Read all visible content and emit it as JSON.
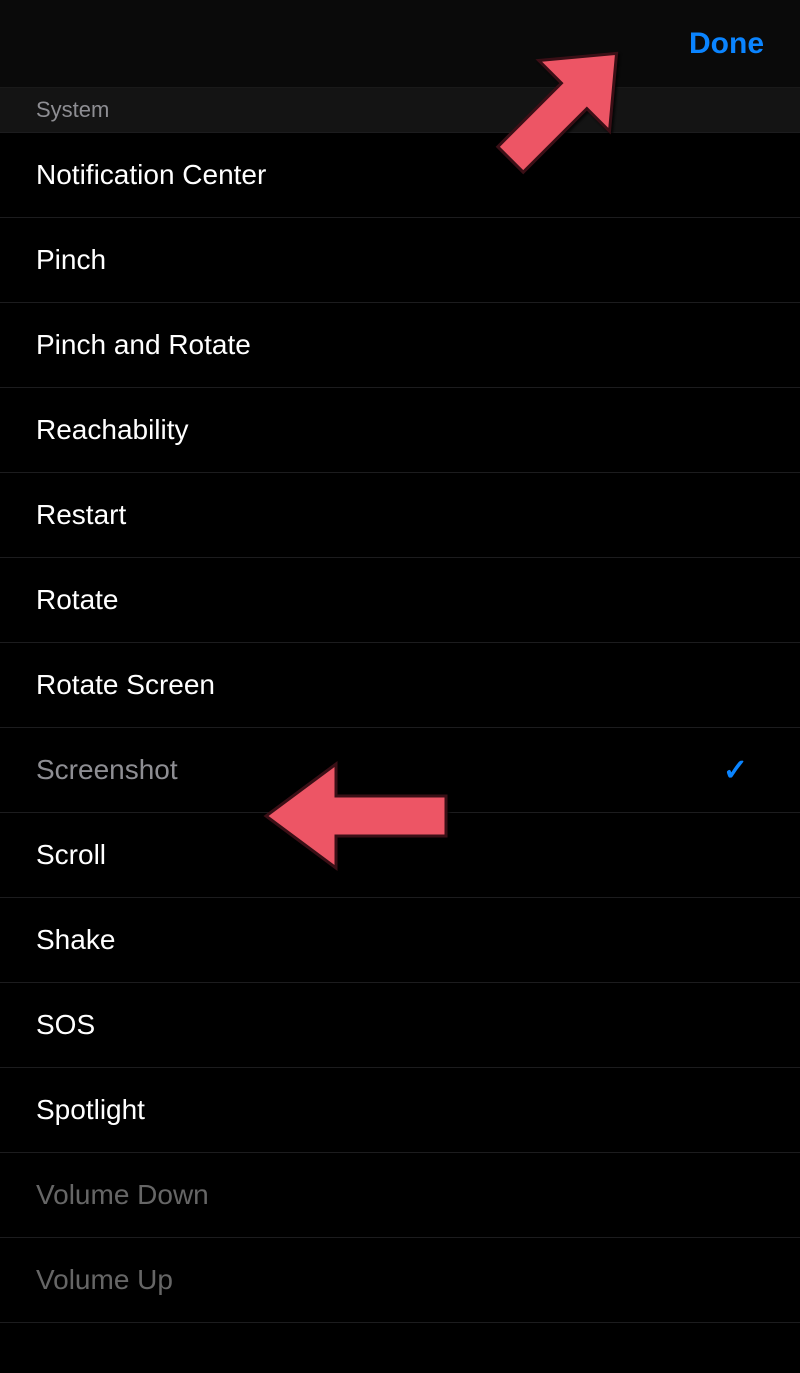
{
  "nav": {
    "done_label": "Done"
  },
  "section": {
    "title": "System"
  },
  "items": [
    {
      "label": "Notification Center",
      "selected": false,
      "disabled": false
    },
    {
      "label": "Pinch",
      "selected": false,
      "disabled": false
    },
    {
      "label": "Pinch and Rotate",
      "selected": false,
      "disabled": false
    },
    {
      "label": "Reachability",
      "selected": false,
      "disabled": false
    },
    {
      "label": "Restart",
      "selected": false,
      "disabled": false
    },
    {
      "label": "Rotate",
      "selected": false,
      "disabled": false
    },
    {
      "label": "Rotate Screen",
      "selected": false,
      "disabled": false
    },
    {
      "label": "Screenshot",
      "selected": true,
      "disabled": false
    },
    {
      "label": "Scroll",
      "selected": false,
      "disabled": false
    },
    {
      "label": "Shake",
      "selected": false,
      "disabled": false
    },
    {
      "label": "SOS",
      "selected": false,
      "disabled": false
    },
    {
      "label": "Spotlight",
      "selected": false,
      "disabled": false
    },
    {
      "label": "Volume Down",
      "selected": false,
      "disabled": true
    },
    {
      "label": "Volume Up",
      "selected": false,
      "disabled": true
    }
  ],
  "colors": {
    "accent": "#0a84ff",
    "annotation_arrow": "#ed5565"
  }
}
